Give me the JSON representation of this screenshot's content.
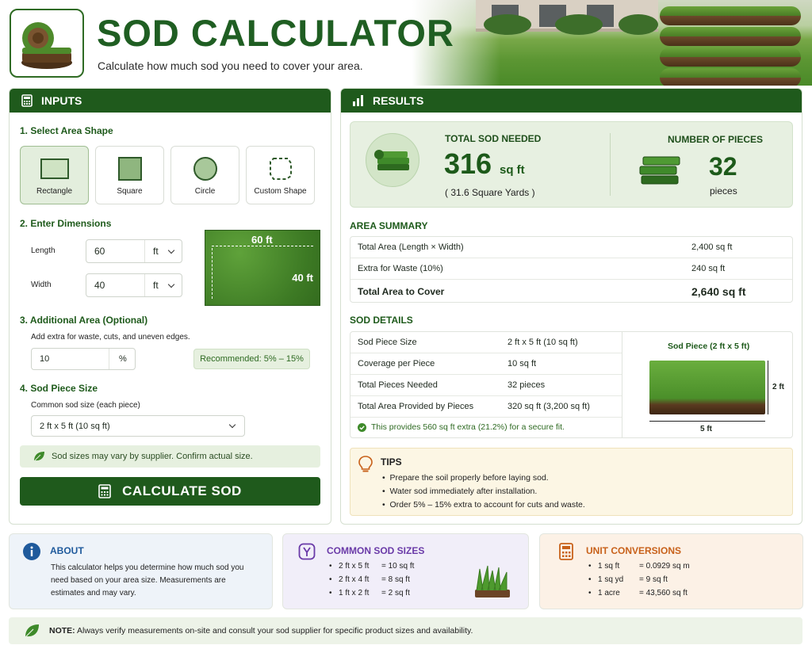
{
  "header": {
    "title": "SOD CALCULATOR",
    "subtitle": "Calculate how much sod you need to cover your area."
  },
  "inputs": {
    "heading": "INPUTS",
    "step1": "1. Select Area Shape",
    "shapes": [
      {
        "label": "Rectangle"
      },
      {
        "label": "Square"
      },
      {
        "label": "Circle"
      },
      {
        "label": "Custom Shape"
      }
    ],
    "step2": "2. Enter Dimensions",
    "length_label": "Length",
    "length_value": "60",
    "length_unit": "ft",
    "width_label": "Width",
    "width_value": "40",
    "width_unit": "ft",
    "preview_length": "60 ft",
    "preview_width": "40 ft",
    "step3": "3. Additional Area (Optional)",
    "waste_help": "Add extra for waste, cuts, and uneven edges.",
    "waste_value": "10",
    "waste_unit": "%",
    "recommended": "Recommended: 5% – 15%",
    "step4": "4. Sod Piece Size",
    "piece_help": "Common sod size (each piece)",
    "piece_value": "2 ft x 5 ft (10 sq ft)",
    "note": "Sod sizes may vary by supplier. Confirm actual size.",
    "calc_button": "CALCULATE SOD"
  },
  "results": {
    "heading": "RESULTS",
    "total_label": "TOTAL SOD NEEDED",
    "total_value": "316",
    "total_unit": "sq ft",
    "total_yards": "( 31.6 Square Yards )",
    "pieces_label": "NUMBER OF PIECES",
    "pieces_value": "32",
    "pieces_unit": "pieces",
    "area_summary_heading": "AREA SUMMARY",
    "area_rows": [
      {
        "label": "Total Area (Length × Width)",
        "value": "2,400 sq ft"
      },
      {
        "label": "Extra for Waste (10%)",
        "value": "240 sq ft"
      },
      {
        "label": "Total Area to Cover",
        "value": "2,640 sq ft"
      }
    ],
    "sod_details_heading": "SOD DETAILS",
    "detail_rows": [
      {
        "label": "Sod Piece Size",
        "value": "2 ft x 5 ft (10 sq ft)"
      },
      {
        "label": "Coverage per Piece",
        "value": "10 sq ft"
      },
      {
        "label": "Total Pieces Needed",
        "value": "32 pieces"
      },
      {
        "label": "Total Area Provided by Pieces",
        "value": "320 sq ft (3,200 sq ft)"
      }
    ],
    "extra_note": "This provides 560 sq ft extra (21.2%) for a secure fit.",
    "piece_title": "Sod Piece (2 ft x 5 ft)",
    "piece_h": "2 ft",
    "piece_w": "5 ft",
    "tips_heading": "TIPS",
    "tips": [
      "Prepare the soil properly before laying sod.",
      "Water sod immediately after installation.",
      "Order 5% – 15% extra to account for cuts and waste."
    ]
  },
  "about": {
    "heading": "ABOUT",
    "text": "This calculator helps you determine how much sod you need based on your area size. Measurements are estimates and may vary."
  },
  "common_sizes": {
    "heading": "COMMON SOD SIZES",
    "items": [
      {
        "size": "2 ft x 5 ft",
        "area": "= 10 sq ft"
      },
      {
        "size": "2 ft x 4 ft",
        "area": "= 8 sq ft"
      },
      {
        "size": "1 ft x 2 ft",
        "area": "= 2 sq ft"
      }
    ]
  },
  "conversions": {
    "heading": "UNIT CONVERSIONS",
    "items": [
      {
        "unit": "1 sq ft",
        "value": "= 0.0929 sq m"
      },
      {
        "unit": "1 sq yd",
        "value": "= 9 sq ft"
      },
      {
        "unit": "1 acre",
        "value": "= 43,560 sq ft"
      }
    ]
  },
  "footer": {
    "note_label": "NOTE:",
    "note_text": "Always verify measurements on-site and consult your sod supplier for specific product sizes and availability."
  },
  "colors": {
    "brand": "#1f5a1c",
    "accent_purple": "#6a3aa8",
    "accent_orange": "#c8611a",
    "accent_blue": "#1f5a9c"
  }
}
